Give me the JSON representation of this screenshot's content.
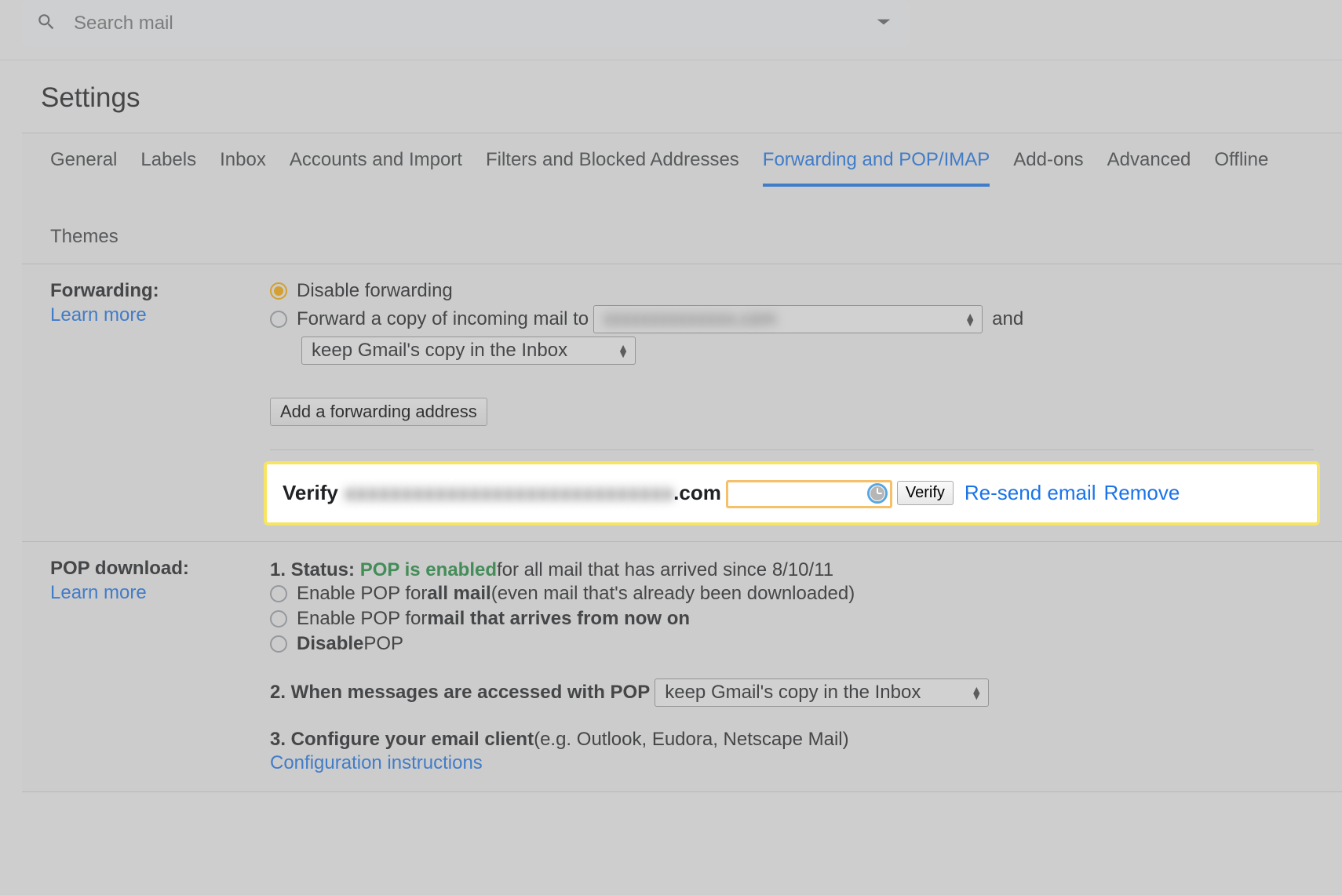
{
  "search": {
    "placeholder": "Search mail"
  },
  "pageTitle": "Settings",
  "tabs": [
    {
      "label": "General",
      "active": false
    },
    {
      "label": "Labels",
      "active": false
    },
    {
      "label": "Inbox",
      "active": false
    },
    {
      "label": "Accounts and Import",
      "active": false
    },
    {
      "label": "Filters and Blocked Addresses",
      "active": false
    },
    {
      "label": "Forwarding and POP/IMAP",
      "active": true
    },
    {
      "label": "Add-ons",
      "active": false
    },
    {
      "label": "Advanced",
      "active": false
    },
    {
      "label": "Offline",
      "active": false
    },
    {
      "label": "Themes",
      "active": false
    }
  ],
  "forwarding": {
    "title": "Forwarding:",
    "learnMore": "Learn more",
    "disableLabel": "Disable forwarding",
    "forwardCopyLabel": "Forward a copy of incoming mail to",
    "forwardAddressBlurred": "xxxxxxxxxxxxxx.com",
    "andText": "and",
    "keepCopySelect": "keep Gmail's copy in the Inbox",
    "addButton": "Add a forwarding address",
    "verify": {
      "prefix": "Verify",
      "emailBlurred": "xxxxxxxxxxxxxxxxxxxxxxxxxxxxx",
      "emailSuffix": ".com",
      "verifyButton": "Verify",
      "resendLink": "Re-send email",
      "removeLink": "Remove"
    }
  },
  "pop": {
    "title": "POP download:",
    "learnMore": "Learn more",
    "statusPrefix": "1. Status:",
    "statusEnabled": "POP is enabled",
    "statusSuffix": " for all mail that has arrived since 8/10/11",
    "enableAllPrefix": "Enable POP for ",
    "enableAllBold": "all mail",
    "enableAllSuffix": " (even mail that's already been downloaded)",
    "enableNewPrefix": "Enable POP for ",
    "enableNewBold": "mail that arrives from now on",
    "disableBold": "Disable",
    "disableSuffix": " POP",
    "whenAccessedLabel": "2. When messages are accessed with POP",
    "whenAccessedSelect": "keep Gmail's copy in the Inbox",
    "configurePrefix": "3. Configure your email client",
    "configureSuffix": " (e.g. Outlook, Eudora, Netscape Mail)",
    "configureLink": "Configuration instructions"
  }
}
